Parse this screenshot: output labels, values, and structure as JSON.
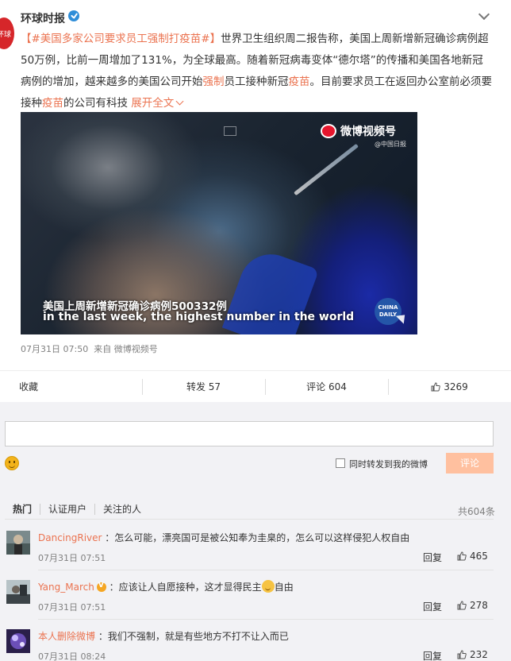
{
  "post": {
    "author": "环球时报",
    "avatar_text": "环球",
    "hashtag": "【#美国多家公司要求员工强制打疫苗#】",
    "text_1": "世界卫生组织周二报告称，美国上周新增新冠确诊病例超50万例，比前一周增加了131%，为全球最高。随着新冠病毒变体“德尔塔”的传播和美国各地新冠病例的增加，越来越多的美国公司开始",
    "hl_1": "强制",
    "text_2": "员工接种新冠",
    "hl_2": "疫苗",
    "text_3": "。目前要求员工在返回办公室前必须要接种",
    "hl_3": "疫苗",
    "text_4": "的公司有科技",
    "expand": "展开全文"
  },
  "video": {
    "logo": "微博视频号",
    "logo_sub": "@中国日报",
    "caption_cn": "美国上周新增新冠确诊病例500332例",
    "caption_en": "in the last week, the highest number in the world",
    "badge": "CHINA DAILY"
  },
  "meta": {
    "time": "07月31日 07:50",
    "from": "来自",
    "source": "微博视频号"
  },
  "actions": {
    "favorite": "收藏",
    "repost": "转发 57",
    "comment": "评论 604",
    "like": "3269"
  },
  "composer": {
    "also_repost": "同时转发到我的微博",
    "submit": "评论"
  },
  "filters": [
    "热门",
    "认证用户",
    "关注的人"
  ],
  "total": "共604条",
  "comments": [
    {
      "user": "DancingRiver",
      "verified": false,
      "text": "：怎么可能，漂亮国可是被公知奉为圭臬的，怎么可以这样侵犯人权自由",
      "text_after_emoji": "",
      "time": "07月31日 07:51",
      "reply": "回复",
      "likes": "465"
    },
    {
      "user": "Yang_March",
      "verified": true,
      "text": "：应该让人自愿接种，这才显得民主",
      "text_after_emoji": "自由",
      "time": "07月31日 07:51",
      "reply": "回复",
      "likes": "278"
    },
    {
      "user": "本人删除微博",
      "verified": false,
      "text": "：我们不强制，就是有些地方不打不让入而已",
      "text_after_emoji": "",
      "time": "07月31日 08:24",
      "reply": "回复",
      "likes": "232"
    }
  ],
  "colors": {
    "accent": "#eb7350",
    "button_disabled": "#ffc09f",
    "verified_blue": "#2f8ed8",
    "verified_gold": "#f5a623",
    "comment_bg": "#f2f2f5"
  }
}
